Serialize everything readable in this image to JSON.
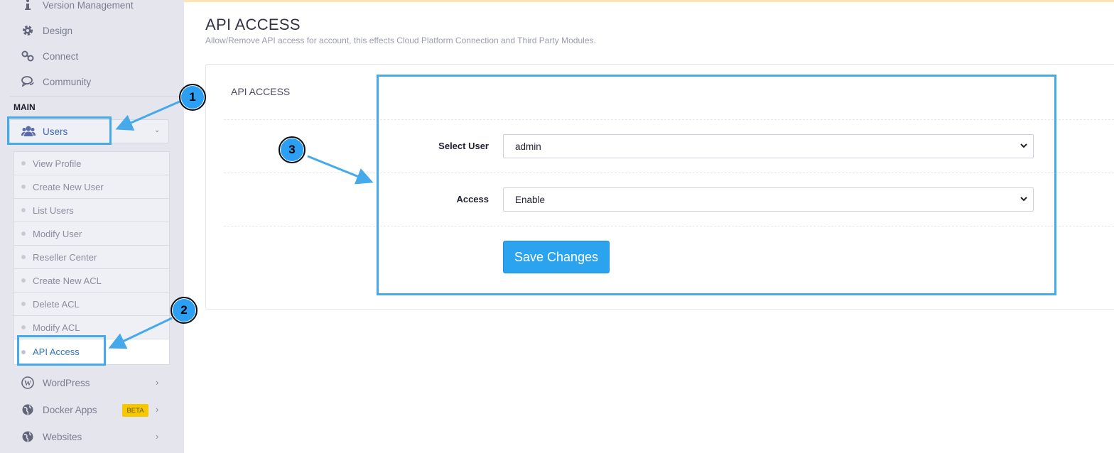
{
  "sidebar": {
    "top_items": [
      {
        "label": "Version Management",
        "icon": "info-icon"
      },
      {
        "label": "Design",
        "icon": "gear-icon"
      },
      {
        "label": "Connect",
        "icon": "link-icon"
      },
      {
        "label": "Community",
        "icon": "comments-icon"
      }
    ],
    "section_label": "MAIN",
    "users": {
      "label": "Users",
      "icon": "users-icon"
    },
    "submenu": [
      "View Profile",
      "Create New User",
      "List Users",
      "Modify User",
      "Reseller Center",
      "Create New ACL",
      "Delete ACL",
      "Modify ACL",
      "API Access"
    ],
    "bottom_items": [
      {
        "label": "WordPress",
        "icon": "wordpress-icon"
      },
      {
        "label": "Docker Apps",
        "icon": "globe-icon",
        "badge": "BETA"
      },
      {
        "label": "Websites",
        "icon": "globe-icon"
      }
    ]
  },
  "page": {
    "title": "API ACCESS",
    "subtitle": "Allow/Remove API access for account, this effects Cloud Platform Connection and Third Party Modules."
  },
  "panel": {
    "title": "API ACCESS",
    "select_user_label": "Select User",
    "select_user_value": "admin",
    "access_label": "Access",
    "access_value": "Enable",
    "save_button": "Save Changes"
  },
  "annotations": {
    "badge1": "1",
    "badge2": "2",
    "badge3": "3"
  },
  "colors": {
    "accent": "#2ba3ef",
    "highlight": "#45a9ea",
    "beta": "#f6c800"
  }
}
